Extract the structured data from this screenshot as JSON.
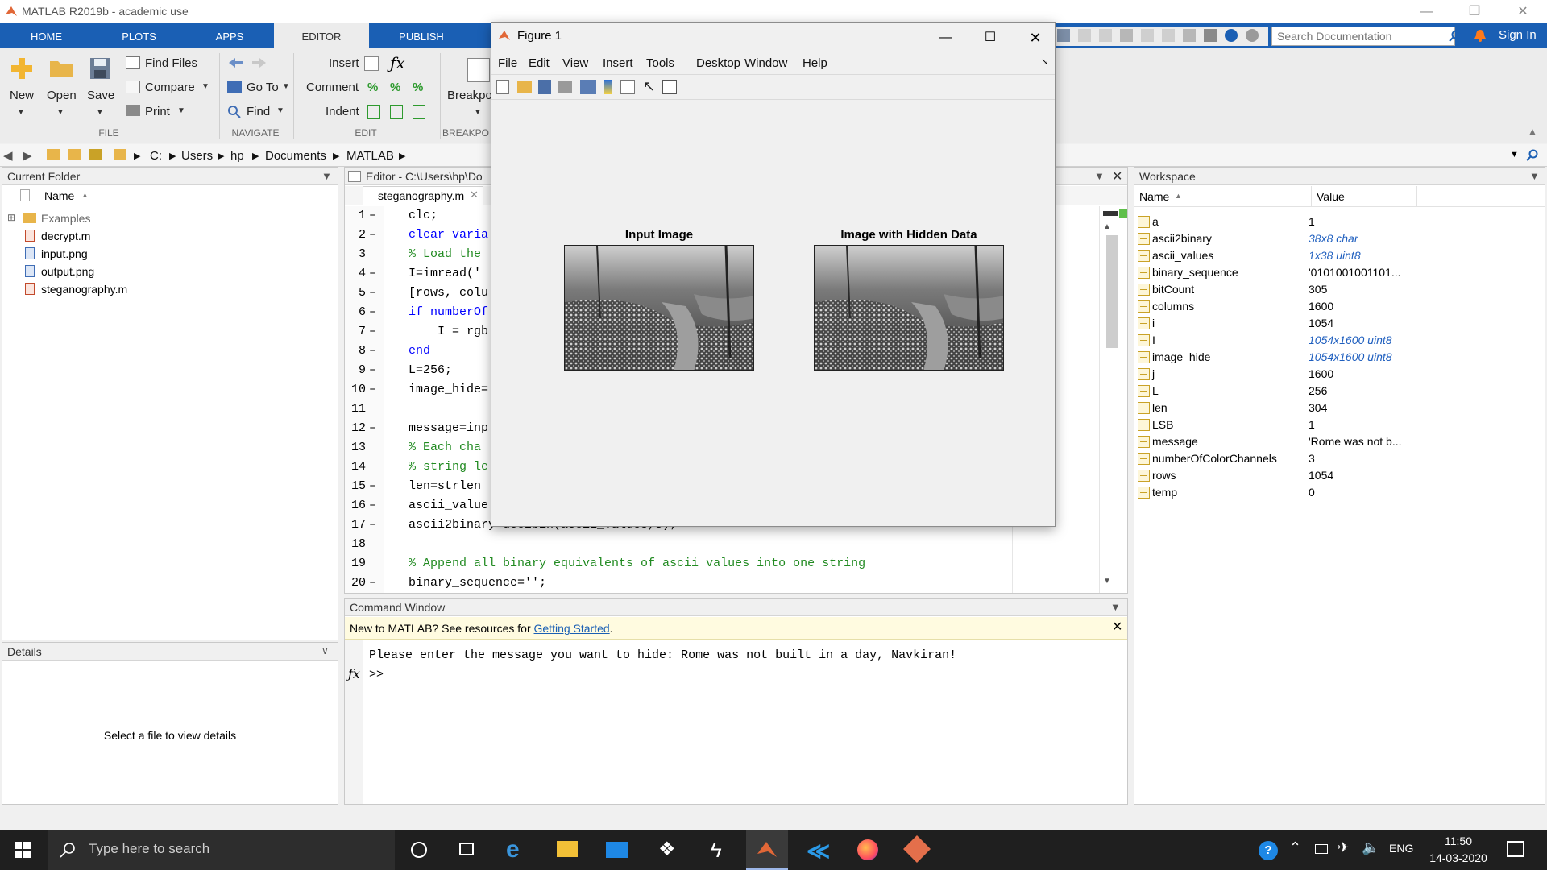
{
  "app": {
    "title": "MATLAB R2019b - academic use"
  },
  "tabs": [
    "HOME",
    "PLOTS",
    "APPS",
    "EDITOR",
    "PUBLISH"
  ],
  "search": {
    "placeholder": "Search Documentation"
  },
  "signin": "Sign In",
  "ribbon": {
    "file": {
      "new": "New",
      "open": "Open",
      "save": "Save",
      "find_files": "Find Files",
      "compare": "Compare",
      "print": "Print",
      "group": "FILE"
    },
    "navigate": {
      "goto": "Go To",
      "find": "Find",
      "group": "NAVIGATE"
    },
    "edit": {
      "insert": "Insert",
      "comment": "Comment",
      "indent": "Indent",
      "group": "EDIT"
    },
    "breakpoints": {
      "label": "Breakpo",
      "group": "BREAKPO"
    }
  },
  "path": [
    "C:",
    "Users",
    "hp",
    "Documents",
    "MATLAB"
  ],
  "current_folder": {
    "title": "Current Folder",
    "column": "Name",
    "items": [
      {
        "name": "Examples",
        "icon": "folder-icon"
      },
      {
        "name": "decrypt.m",
        "icon": "m-file-icon"
      },
      {
        "name": "input.png",
        "icon": "image-file-icon"
      },
      {
        "name": "output.png",
        "icon": "image-file-icon"
      },
      {
        "name": "steganography.m",
        "icon": "m-file-icon"
      }
    ]
  },
  "details": {
    "title": "Details",
    "empty": "Select a file to view details"
  },
  "editor": {
    "title": "Editor - C:\\Users\\hp\\Do",
    "tab": "steganography.m",
    "lines": [
      {
        "n": "1",
        "dash": "–",
        "code": "   clc;"
      },
      {
        "n": "2",
        "dash": "–",
        "code": "   clear varia"
      },
      {
        "n": "3",
        "dash": "",
        "code": "   % Load the"
      },
      {
        "n": "4",
        "dash": "–",
        "code": "   I=imread('"
      },
      {
        "n": "5",
        "dash": "–",
        "code": "   [rows, colu"
      },
      {
        "n": "6",
        "dash": "–",
        "code": "   if numberOf"
      },
      {
        "n": "7",
        "dash": "–",
        "code": "       I = rgb"
      },
      {
        "n": "8",
        "dash": "–",
        "code": "   end"
      },
      {
        "n": "9",
        "dash": "–",
        "code": "   L=256;"
      },
      {
        "n": "10",
        "dash": "–",
        "code": "   image_hide="
      },
      {
        "n": "11",
        "dash": "",
        "code": ""
      },
      {
        "n": "12",
        "dash": "–",
        "code": "   message=inp"
      },
      {
        "n": "13",
        "dash": "",
        "code": "   % Each cha"
      },
      {
        "n": "14",
        "dash": "",
        "code": "   % string le"
      },
      {
        "n": "15",
        "dash": "–",
        "code": "   len=strlen"
      },
      {
        "n": "16",
        "dash": "–",
        "code": "   ascii_value"
      },
      {
        "n": "17",
        "dash": "–",
        "code": "   ascii2binary=dec2bin(ascii_values,8);"
      },
      {
        "n": "18",
        "dash": "",
        "code": ""
      },
      {
        "n": "19",
        "dash": "",
        "code": "   % Append all binary equivalents of ascii values into one string"
      },
      {
        "n": "20",
        "dash": "–",
        "code": "   binary_sequence='';"
      }
    ]
  },
  "command_window": {
    "title": "Command Window",
    "banner_text": "New to MATLAB? See resources for ",
    "banner_link": "Getting Started",
    "banner_end": ".",
    "output": "Please enter the message you want to hide: Rome was not built in a day, Navkiran!",
    "prompt": ">>"
  },
  "workspace": {
    "title": "Workspace",
    "col_name": "Name",
    "col_value": "Value",
    "vars": [
      {
        "name": "a",
        "value": "1",
        "italic": false
      },
      {
        "name": "ascii2binary",
        "value": "38x8 char",
        "italic": true
      },
      {
        "name": "ascii_values",
        "value": "1x38 uint8",
        "italic": true
      },
      {
        "name": "binary_sequence",
        "value": "'0101001001101...",
        "italic": false
      },
      {
        "name": "bitCount",
        "value": "305",
        "italic": false
      },
      {
        "name": "columns",
        "value": "1600",
        "italic": false
      },
      {
        "name": "i",
        "value": "1054",
        "italic": false
      },
      {
        "name": "I",
        "value": "1054x1600 uint8",
        "italic": true
      },
      {
        "name": "image_hide",
        "value": "1054x1600 uint8",
        "italic": true
      },
      {
        "name": "j",
        "value": "1600",
        "italic": false
      },
      {
        "name": "L",
        "value": "256",
        "italic": false
      },
      {
        "name": "len",
        "value": "304",
        "italic": false
      },
      {
        "name": "LSB",
        "value": "1",
        "italic": false
      },
      {
        "name": "message",
        "value": "'Rome was not b...",
        "italic": false
      },
      {
        "name": "numberOfColorChannels",
        "value": "3",
        "italic": false
      },
      {
        "name": "rows",
        "value": "1054",
        "italic": false
      },
      {
        "name": "temp",
        "value": "0",
        "italic": false
      }
    ]
  },
  "figure": {
    "title": "Figure 1",
    "menu": [
      "File",
      "Edit",
      "View",
      "Insert",
      "Tools",
      "Desktop",
      "Window",
      "Help"
    ],
    "plot1_title": "Input Image",
    "plot2_title": "Image with Hidden Data"
  },
  "taskbar": {
    "search_placeholder": "Type here to search",
    "lang": "ENG",
    "time": "11:50",
    "date": "14-03-2020"
  }
}
